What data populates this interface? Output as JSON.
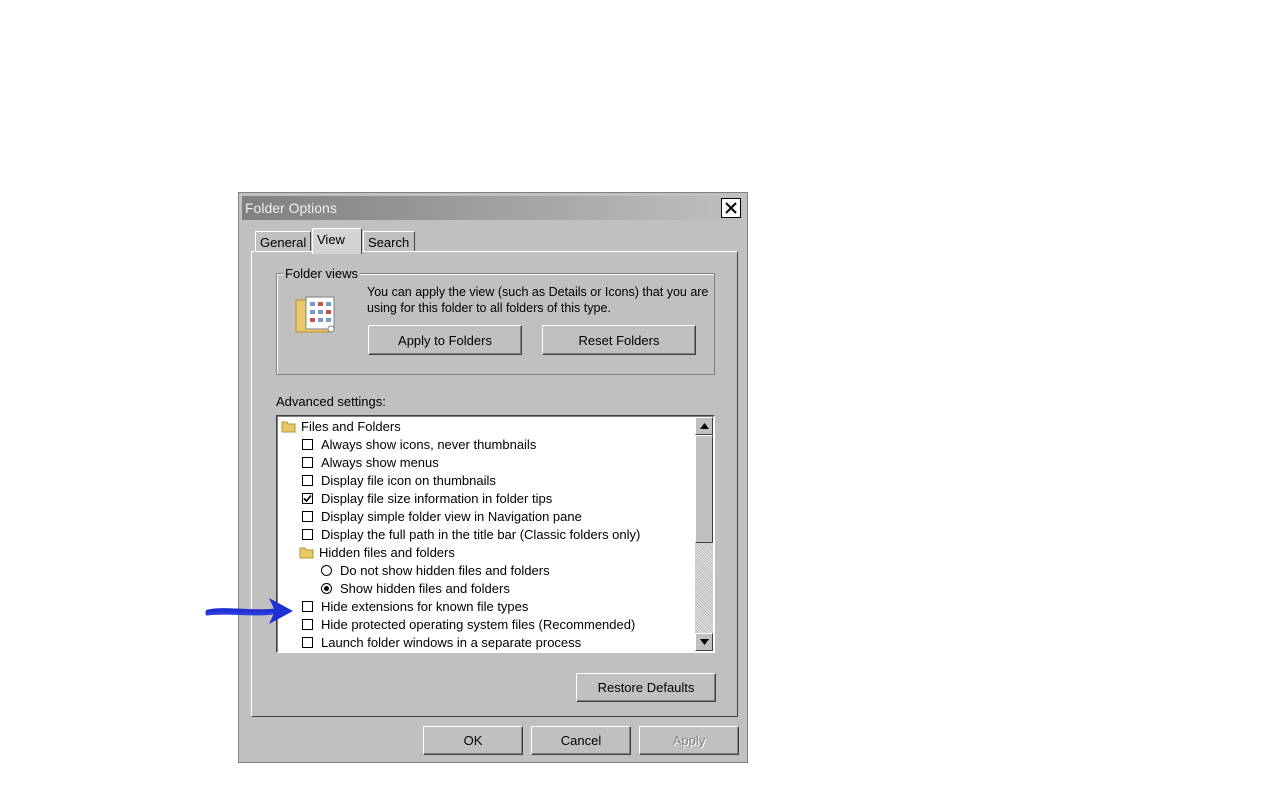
{
  "dialog": {
    "title": "Folder Options",
    "tabs": [
      {
        "label": "General",
        "active": false
      },
      {
        "label": "View",
        "active": true
      },
      {
        "label": "Search",
        "active": false
      }
    ],
    "folder_views": {
      "label": "Folder views",
      "description": "You can apply the view (such as Details or Icons) that you are using for this folder to all folders of this type.",
      "apply_button": "Apply to Folders",
      "reset_button": "Reset Folders"
    },
    "advanced": {
      "label": "Advanced settings:",
      "items": [
        {
          "type": "folder",
          "label": "Files and Folders"
        },
        {
          "type": "checkbox",
          "checked": false,
          "label": "Always show icons, never thumbnails"
        },
        {
          "type": "checkbox",
          "checked": false,
          "label": "Always show menus"
        },
        {
          "type": "checkbox",
          "checked": false,
          "label": "Display file icon on thumbnails"
        },
        {
          "type": "checkbox",
          "checked": true,
          "label": "Display file size information in folder tips"
        },
        {
          "type": "checkbox",
          "checked": false,
          "label": "Display simple folder view in Navigation pane"
        },
        {
          "type": "checkbox",
          "checked": false,
          "label": "Display the full path in the title bar (Classic folders only)"
        },
        {
          "type": "folder",
          "label": "Hidden files and folders"
        },
        {
          "type": "radio",
          "checked": false,
          "label": "Do not show hidden files and folders"
        },
        {
          "type": "radio",
          "checked": true,
          "label": "Show hidden files and folders"
        },
        {
          "type": "checkbox",
          "checked": false,
          "label": "Hide extensions for known file types"
        },
        {
          "type": "checkbox",
          "checked": false,
          "label": "Hide protected operating system files (Recommended)"
        },
        {
          "type": "checkbox",
          "checked": false,
          "label": "Launch folder windows in a separate process"
        }
      ]
    },
    "restore_button": "Restore Defaults",
    "ok_button": "OK",
    "cancel_button": "Cancel",
    "apply_button": "Apply"
  },
  "annotation": {
    "color": "#1f2fd0"
  }
}
